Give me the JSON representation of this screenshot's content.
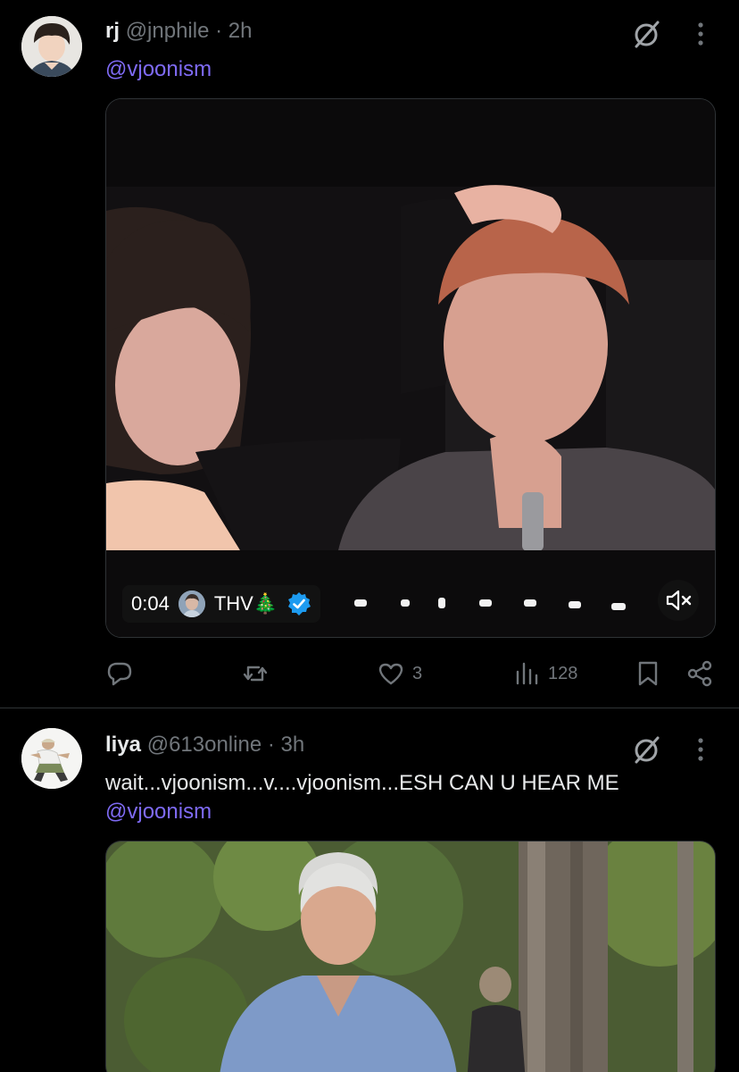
{
  "tweets": [
    {
      "name": "rj",
      "handle": "@jnphile",
      "separator": "·",
      "time": "2h",
      "mention": "@vjoonism",
      "video": {
        "time": "0:04",
        "channel": "THV🎄"
      },
      "stats": {
        "likes": "3",
        "views": "128"
      }
    },
    {
      "name": "liya",
      "handle": "@613online",
      "separator": "·",
      "time": "3h",
      "text": "wait...vjoonism...v....vjoonism...ESH CAN U HEAR ME",
      "mention": "@vjoonism"
    }
  ],
  "icons": {
    "grok": "grok-slash-icon",
    "more": "more-vertical-icon",
    "reply": "reply-icon",
    "retweet": "retweet-icon",
    "like": "heart-icon",
    "views": "analytics-icon",
    "bookmark": "bookmark-icon",
    "share": "share-icon",
    "verified": "verified-badge-icon",
    "mute": "muted-speaker-icon"
  },
  "colors": {
    "background": "#000000",
    "mention": "#7f6bf5",
    "secondary_text": "#71767b",
    "verified": "#1d9bf0"
  }
}
